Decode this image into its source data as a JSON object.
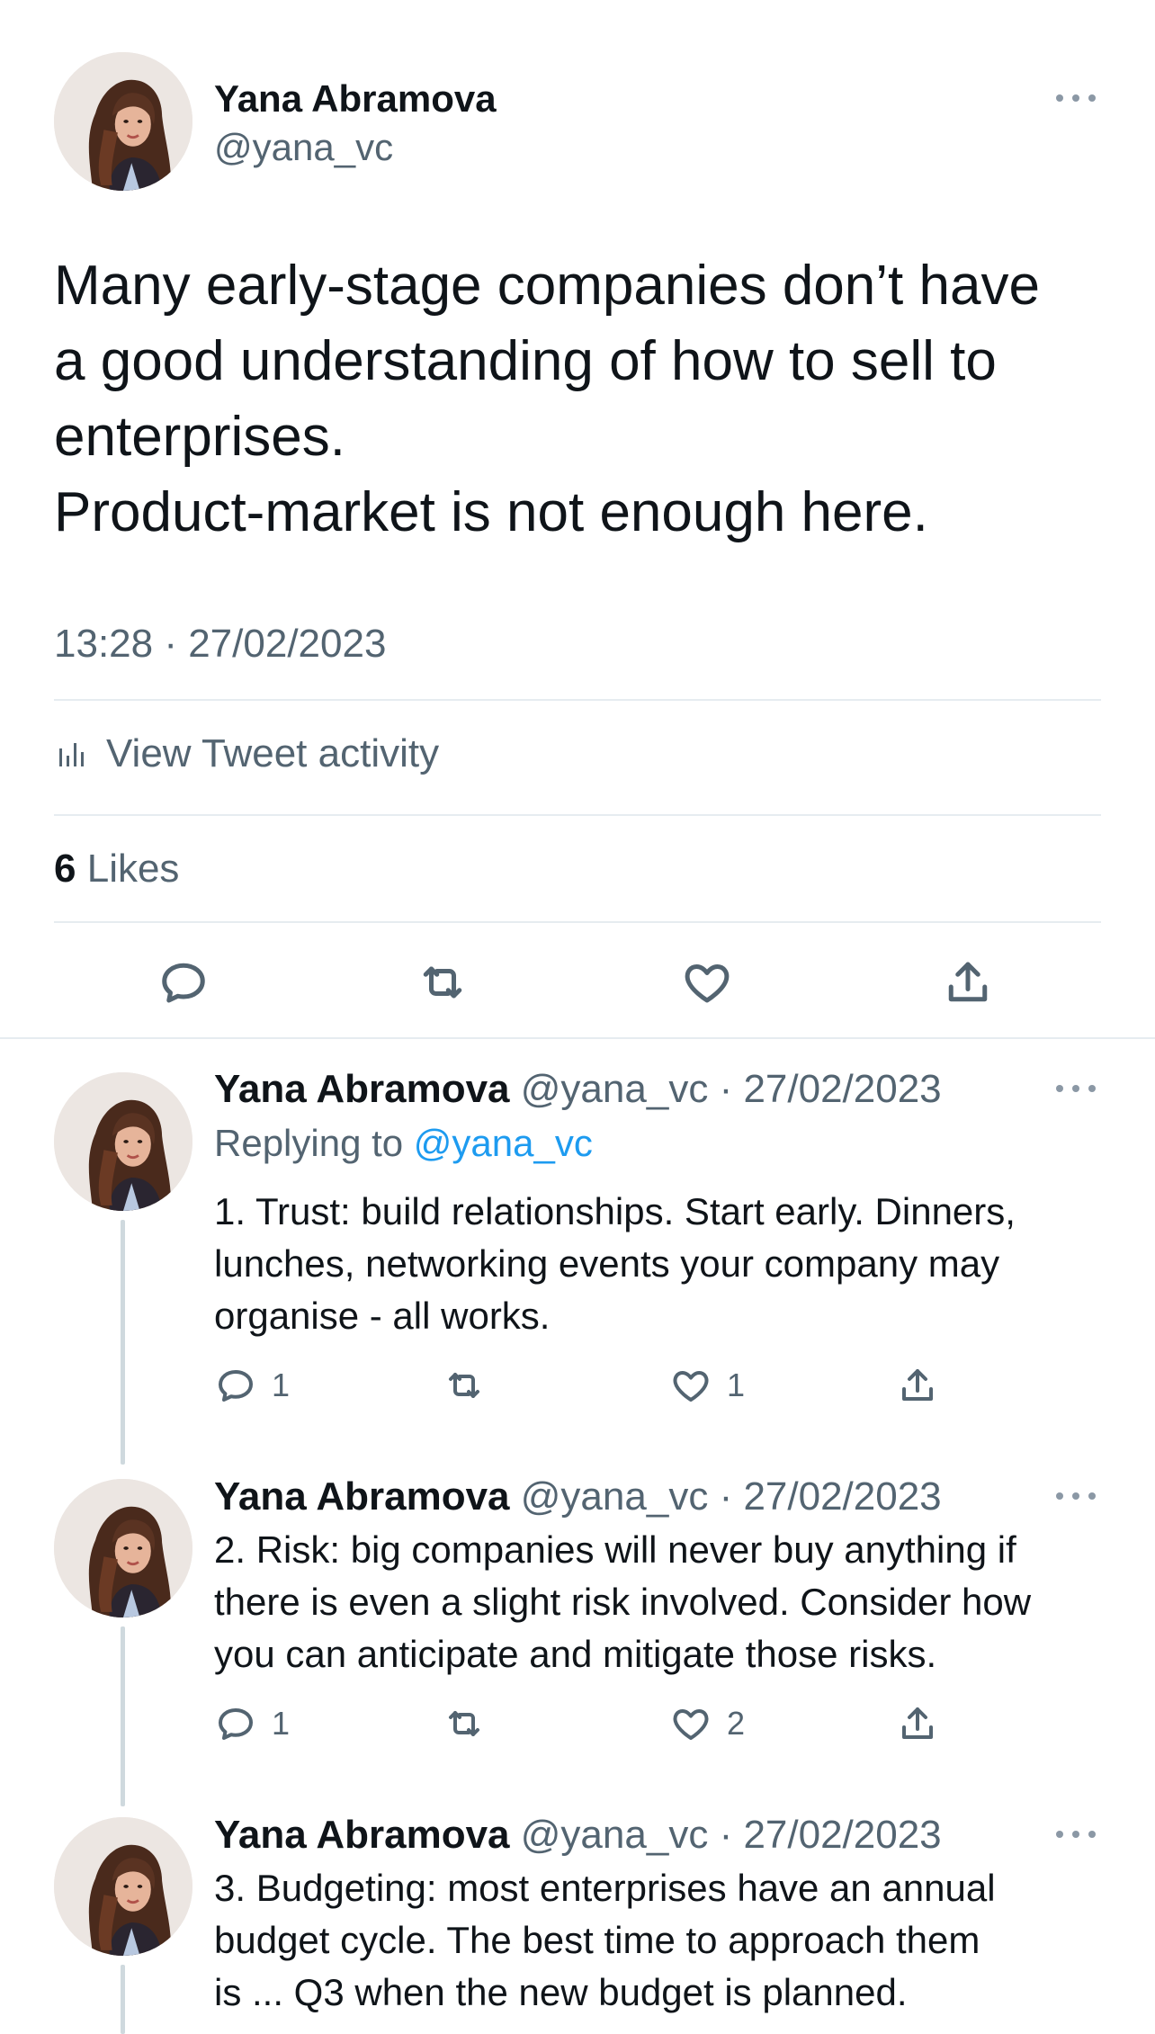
{
  "main_tweet": {
    "author_name": "Yana Abramova",
    "author_handle": "@yana_vc",
    "text_lines": [
      "Many early-stage companies don’t have",
      "a good understanding of how to sell to",
      "enterprises.",
      "Product-market is not enough here."
    ],
    "timestamp": "13:28 · 27/02/2023",
    "activity_label": "View Tweet activity",
    "likes_count": "6",
    "likes_label": "Likes"
  },
  "replies": [
    {
      "author_name": "Yana Abramova",
      "author_handle": "@yana_vc",
      "date": "· 27/02/2023",
      "replying_prefix": "Replying to",
      "replying_handle": "@yana_vc",
      "text_lines": [
        "1. Trust: build relationships. Start early. Dinners,",
        "lunches, networking events your company may",
        "organise - all works."
      ],
      "reply_count": "1",
      "retweet_count": "",
      "like_count": "1"
    },
    {
      "author_name": "Yana Abramova",
      "author_handle": "@yana_vc",
      "date": "· 27/02/2023",
      "text_lines": [
        "2. Risk: big companies will never buy anything if",
        "there is even a slight risk involved. Consider how",
        "you can anticipate and mitigate those risks."
      ],
      "reply_count": "1",
      "retweet_count": "",
      "like_count": "2"
    },
    {
      "author_name": "Yana Abramova",
      "author_handle": "@yana_vc",
      "date": "· 27/02/2023",
      "text_lines": [
        "3. Budgeting: most enterprises have an annual",
        "budget cycle. The best time to approach them",
        "is ... Q3 when the new budget is planned."
      ]
    }
  ],
  "icons": {
    "more": "more-horizontal-icon",
    "activity": "bar-chart-icon",
    "reply": "speech-bubble-icon",
    "retweet": "retweet-icon",
    "like": "heart-icon",
    "share": "share-upload-icon"
  },
  "colors": {
    "text": "#0f1419",
    "muted": "#536471",
    "link": "#1d9bf0",
    "divider": "#e6ecf0",
    "thread_line": "#cfd9de"
  }
}
